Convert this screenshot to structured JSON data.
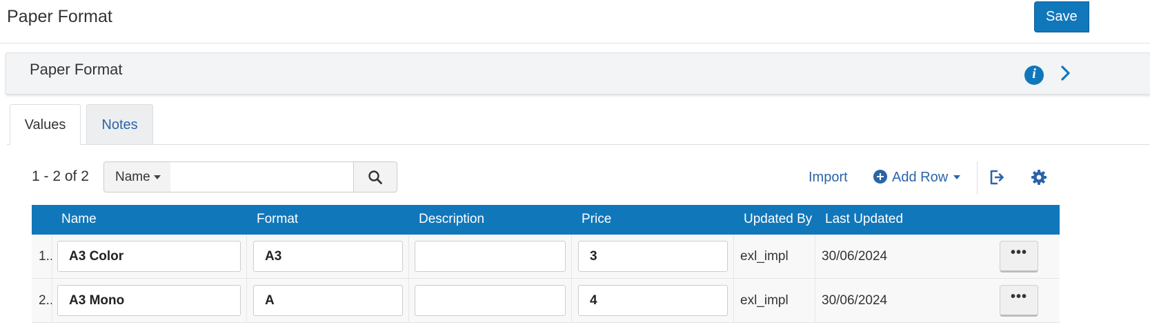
{
  "page": {
    "title": "Paper Format",
    "save_label": "Save"
  },
  "section": {
    "title": "Paper Format"
  },
  "tabs": [
    {
      "label": "Values",
      "active": true
    },
    {
      "label": "Notes",
      "active": false
    }
  ],
  "toolbar": {
    "count": "1 - 2 of 2",
    "search_field": "Name",
    "search_value": "",
    "import_label": "Import",
    "add_row_label": "Add Row"
  },
  "table": {
    "headers": {
      "name": "Name",
      "format": "Format",
      "description": "Description",
      "price": "Price",
      "updated_by": "Updated By",
      "last_updated": "Last Updated"
    },
    "rows": [
      {
        "num": "1..",
        "name": "A3 Color",
        "format": "A3",
        "description": "",
        "price": "3",
        "updated_by": "exl_impl",
        "last_updated": "30/06/2024"
      },
      {
        "num": "2..",
        "name": "A3 Mono",
        "format": "A",
        "description": "",
        "price": "4",
        "updated_by": "exl_impl",
        "last_updated": "30/06/2024"
      }
    ]
  },
  "colors": {
    "primary": "#1177bb",
    "link": "#2a64a8",
    "panel": "#f2f4f5"
  },
  "icons": [
    "info-icon",
    "chevron-right-icon",
    "search-icon",
    "plus-circle-icon",
    "caret-down-icon",
    "export-icon",
    "gear-icon",
    "more-icon"
  ]
}
